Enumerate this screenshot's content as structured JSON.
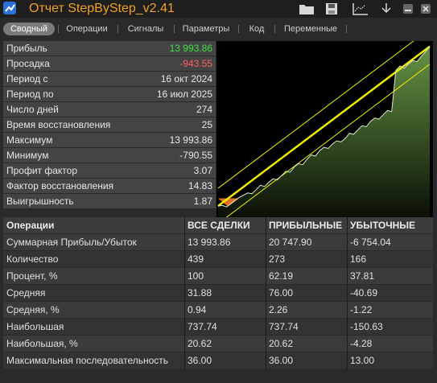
{
  "window": {
    "title": "Отчет StepByStep_v2.41"
  },
  "toolbar_icons": [
    "folder-icon",
    "save-icon",
    "chart-settings-icon",
    "download-arrow-icon",
    "minimize-icon",
    "close-icon"
  ],
  "tabs": [
    {
      "label": "Сводный",
      "active": true
    },
    {
      "label": "Операции"
    },
    {
      "label": "Сигналы"
    },
    {
      "label": "Параметры"
    },
    {
      "label": "Код"
    },
    {
      "label": "Переменные"
    }
  ],
  "summary": [
    {
      "label": "Прибыль",
      "value": "13 993.86",
      "color": "#3fe03f"
    },
    {
      "label": "Просадка",
      "value": "-943.55",
      "color": "#ff6060"
    },
    {
      "label": "Период с",
      "value": "16 окт 2024"
    },
    {
      "label": "Период по",
      "value": "16 июл 2025"
    },
    {
      "label": "Число дней",
      "value": "274"
    },
    {
      "label": "Время восстановления",
      "value": "25"
    },
    {
      "label": "Максимум",
      "value": "13 993.86"
    },
    {
      "label": "Минимум",
      "value": "-790.55"
    },
    {
      "label": "Профит фактор",
      "value": "3.07"
    },
    {
      "label": "Фактор восстановления",
      "value": "14.83"
    },
    {
      "label": "Выигрышность",
      "value": "1.87"
    }
  ],
  "ops_table": {
    "headers": [
      "Операции",
      "ВСЕ СДЕЛКИ",
      "ПРИБЫЛЬНЫЕ",
      "УБЫТОЧНЫЕ"
    ],
    "rows": [
      [
        "Суммарная Прибыль/Убыток",
        "13 993.86",
        "20 747.90",
        "-6 754.04"
      ],
      [
        "Количество",
        "439",
        "273",
        "166"
      ],
      [
        "Процент, %",
        "100",
        "62.19",
        "37.81"
      ],
      [
        "Средняя",
        "31.88",
        "76.00",
        "-40.69"
      ],
      [
        "Средняя, %",
        "0.94",
        "2.26",
        "-1.22"
      ],
      [
        "Наибольшая",
        "737.74",
        "737.74",
        "-150.63"
      ],
      [
        "Наибольшая, %",
        "20.62",
        "20.62",
        "-4.28"
      ],
      [
        "Максимальная последовательность",
        "36.00",
        "36.00",
        "13.00"
      ]
    ]
  },
  "equity": {
    "colors": {
      "line": "#f0f000",
      "fill": "#5a8a40",
      "drawdown": "#e07020",
      "curve": "#d8e8c8"
    },
    "points": [
      -700,
      -650,
      -790,
      -500,
      -200,
      100,
      300,
      500,
      420,
      800,
      1200,
      1100,
      1500,
      1800,
      1700,
      2100,
      2500,
      2400,
      2900,
      3200,
      3100,
      3600,
      4000,
      3900,
      4400,
      4700,
      4600,
      5000,
      5300,
      5200,
      5500,
      6000,
      5900,
      6300,
      6700,
      6600,
      7100,
      7400,
      7300,
      7700,
      8100,
      8000,
      11800,
      12200,
      12000,
      12400,
      12700,
      12600,
      13100,
      13500,
      13993.86
    ]
  }
}
